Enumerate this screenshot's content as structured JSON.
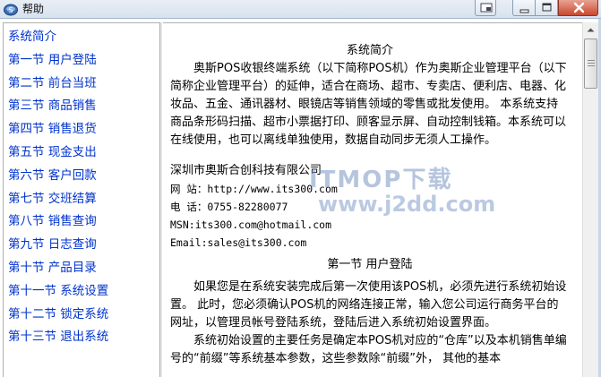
{
  "window": {
    "title": "帮助",
    "colors": {
      "nav_link": "#0033cc",
      "close_button": "#c8482f",
      "titlebar": "#dbe4ef"
    }
  },
  "sidebar": {
    "items": [
      {
        "label": "系统简介"
      },
      {
        "label": "第一节  用户登陆"
      },
      {
        "label": "第二节  前台当班"
      },
      {
        "label": "第三节  商品销售"
      },
      {
        "label": "第四节  销售退货"
      },
      {
        "label": "第五节  现金支出"
      },
      {
        "label": "第六节  客户回款"
      },
      {
        "label": "第七节  交班结算"
      },
      {
        "label": "第八节  销售查询"
      },
      {
        "label": "第九节  日志查询"
      },
      {
        "label": "第十节  产品目录"
      },
      {
        "label": "第十一节  系统设置"
      },
      {
        "label": "第十二节  锁定系统"
      },
      {
        "label": "第十三节  退出系统"
      }
    ]
  },
  "content": {
    "heading": "系统简介",
    "intro": "奥斯POS收银终端系统（以下简称POS机）作为奥斯企业管理平台（以下简称企业管理平台）的延伸，适合在商场、超市、专卖店、便利店、电器、化妆品、五金、通讯器材、眼镜店等销售领域的零售或批发使用。 本系统支持商品条形码扫描、超市小票据打印、顾客显示屏、自动控制钱箱。本系统可以在线使用，也可以离线单独使用，数据自动同步无须人工操作。",
    "company": "深圳市奥斯合创科技有限公司",
    "website": "网 站：http://www.its300.com",
    "phone": "电 话：0755-82280077",
    "msn": "MSN:its300.com@hotmail.com",
    "email": "Email:sales@its300.com",
    "section1_heading": "第一节  用户登陆",
    "section1_para1": "如果您是在系统安装完成后第一次使用该POS机，必须先进行系统初始设置。 此时，您必须确认POS机的网络连接正常，输入您公司运行商务平台的网址，以管理员帐号登陆系统，登陆后进入系统初始设置界面。",
    "section1_para2": "系统初始设置的主要任务是确定本POS机对应的“仓库”以及本机销售单编号的“前缀”等系统基本参数，这些参数除“前缀”外， 其他的基本"
  },
  "watermark": {
    "main": "ITMOP下载",
    "sub": "www.j2dd.com"
  },
  "icons": {
    "app": "help-app-icon",
    "tray": "tray-icon",
    "minimize": "minimize-icon",
    "maximize": "maximize-icon",
    "close": "close-icon",
    "scroll_up": "arrow-up-icon"
  }
}
